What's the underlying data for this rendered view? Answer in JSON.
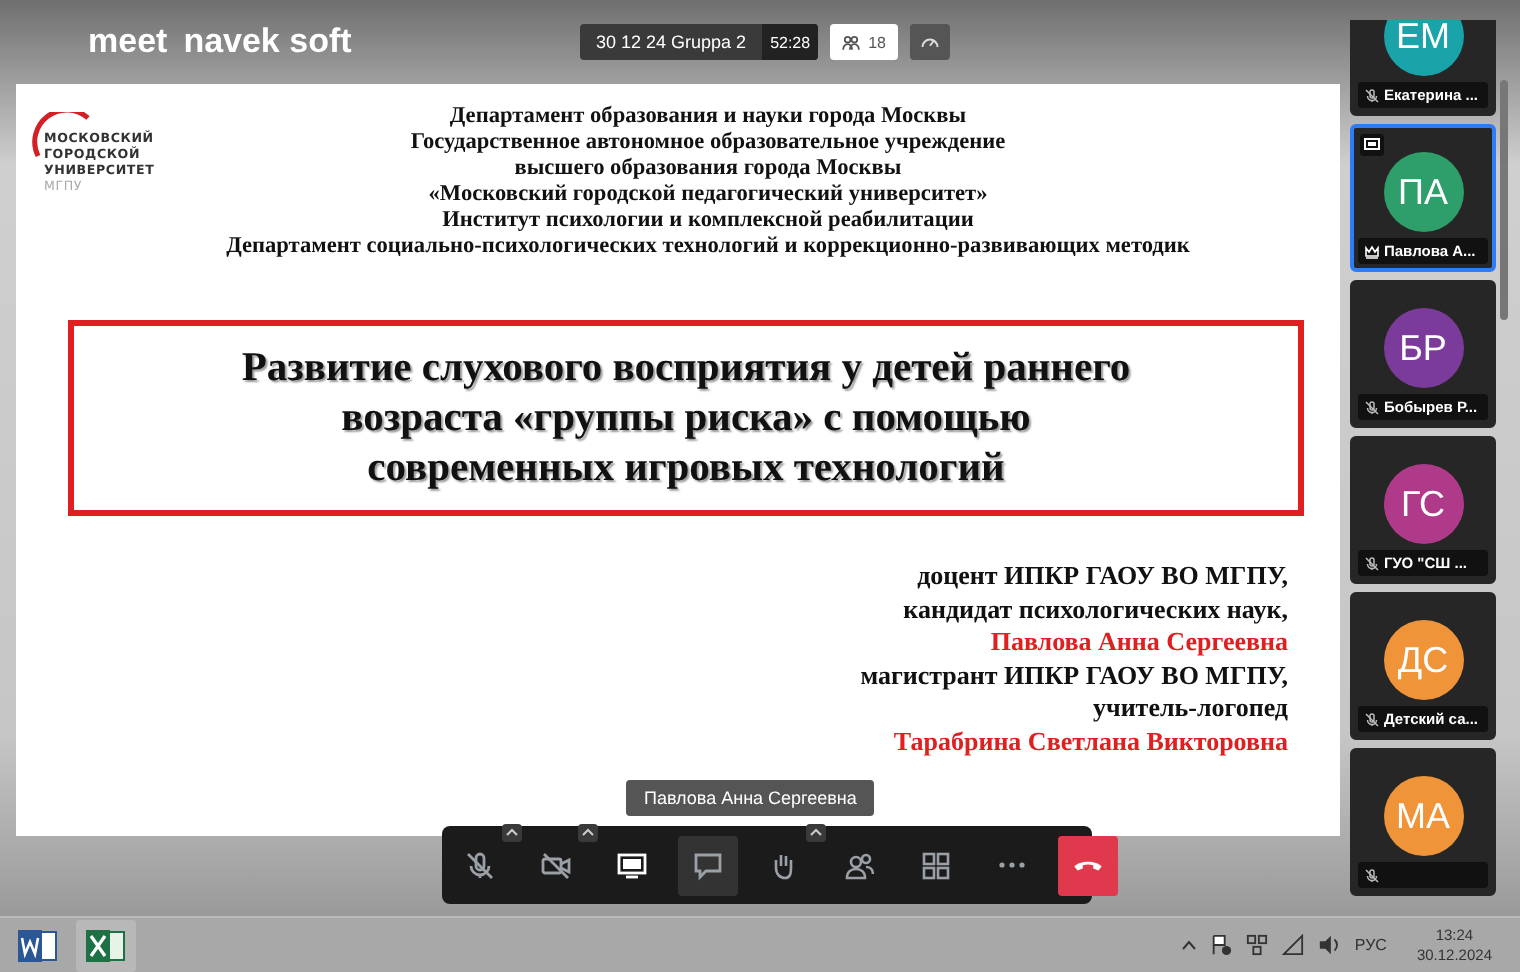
{
  "top_bar": {
    "logo": [
      "meet",
      "navek soft"
    ],
    "meeting_title": "30 12 24 Gruppa 2",
    "timer": "52:28",
    "participant_count": "18"
  },
  "slide": {
    "university_logo": [
      "МОСКОВСКИЙ",
      "ГОРОДСКОЙ",
      "УНИВЕРСИТЕТ",
      "МГПУ"
    ],
    "header_lines": [
      "Департамент образования и науки города Москвы",
      "Государственное автономное образовательное учреждение",
      "высшего образования города Москвы",
      "«Московский городской педагогический университет»",
      "Институт психологии и комплексной реабилитации",
      "Департамент социально-психологических технологий и коррекционно-развивающих методик"
    ],
    "title": "Развитие слухового восприятия  у детей раннего возраста «группы риска» с помощью современных игровых технологий",
    "authors": [
      {
        "text": "доцент ИПКР ГАОУ ВО МГПУ,",
        "kind": "role"
      },
      {
        "text": "кандидат психологических наук,",
        "kind": "role"
      },
      {
        "text": "Павлова Анна Сергеевна",
        "kind": "name"
      },
      {
        "text": "магистрант ИПКР ГАОУ ВО МГПУ,",
        "kind": "role"
      },
      {
        "text": "учитель-логопед",
        "kind": "role"
      },
      {
        "text": "Тарабрина Светлана Викторовна",
        "kind": "name"
      }
    ]
  },
  "speaker_tooltip": "Павлова Анна Сергеевна",
  "participants": [
    {
      "initials": "ЕМ",
      "name": "Екатерина ...",
      "color": "#1aa3a8",
      "muted": true,
      "sharing": false,
      "host": false,
      "selected": false
    },
    {
      "initials": "ПА",
      "name": "Павлова А...",
      "color": "#2e9e6a",
      "muted": false,
      "sharing": true,
      "host": true,
      "selected": true
    },
    {
      "initials": "БР",
      "name": "Бобырев Р...",
      "color": "#7b3b9a",
      "muted": true,
      "sharing": false,
      "host": false,
      "selected": false
    },
    {
      "initials": "ГС",
      "name": "ГУО \"СШ ...",
      "color": "#b03a8a",
      "muted": true,
      "sharing": false,
      "host": false,
      "selected": false
    },
    {
      "initials": "ДС",
      "name": "Детский са...",
      "color": "#f0943a",
      "muted": true,
      "sharing": false,
      "host": false,
      "selected": false
    },
    {
      "initials": "МА",
      "color": "#f0943a",
      "muted": true,
      "sharing": false,
      "host": false,
      "selected": false
    }
  ],
  "toolbar": [
    {
      "kind": "mic",
      "off": true,
      "caret": true,
      "selected": false
    },
    {
      "kind": "camera",
      "off": true,
      "caret": true,
      "selected": false
    },
    {
      "kind": "screen",
      "caret": false,
      "selected": false
    },
    {
      "kind": "chat",
      "caret": false,
      "selected": true
    },
    {
      "kind": "hand",
      "caret": true,
      "selected": false
    },
    {
      "kind": "people",
      "caret": false,
      "selected": false
    },
    {
      "kind": "grid",
      "caret": false,
      "selected": false
    },
    {
      "kind": "more",
      "caret": false,
      "selected": false
    },
    {
      "kind": "hangup",
      "caret": false,
      "selected": false
    }
  ],
  "taskbar": {
    "apps": [
      {
        "kind": "word"
      },
      {
        "kind": "excel"
      }
    ],
    "language": "РУС",
    "time": "13:24",
    "date": "30.12.2024"
  }
}
